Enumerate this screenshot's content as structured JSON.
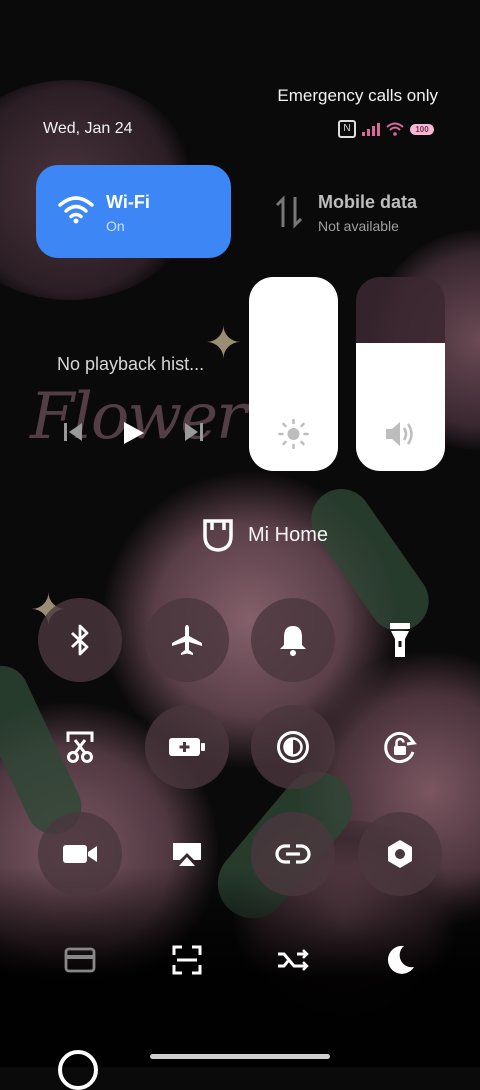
{
  "status": {
    "emergency": "Emergency calls only",
    "date": "Wed, Jan 24",
    "battery": "100"
  },
  "tiles": {
    "wifi": {
      "title": "Wi-Fi",
      "state": "On"
    },
    "mobile": {
      "title": "Mobile data",
      "state": "Not available"
    }
  },
  "media": {
    "title": "No playback hist..."
  },
  "sliders": {
    "brightness_level": 1.0,
    "volume_level": 0.66
  },
  "mihome": {
    "label": "Mi Home"
  },
  "decor": {
    "wallpaper_text": "Flower"
  },
  "toggles": [
    {
      "name": "bluetooth-icon"
    },
    {
      "name": "airplane-icon"
    },
    {
      "name": "bell-icon"
    },
    {
      "name": "flashlight-icon"
    },
    {
      "name": "screenshot-icon"
    },
    {
      "name": "battery-saver-icon"
    },
    {
      "name": "dark-mode-icon"
    },
    {
      "name": "auto-rotate-icon"
    },
    {
      "name": "video-camera-icon"
    },
    {
      "name": "cast-icon"
    },
    {
      "name": "link-icon"
    },
    {
      "name": "settings-icon"
    },
    {
      "name": "card-icon"
    },
    {
      "name": "scan-icon"
    },
    {
      "name": "swap-icon"
    },
    {
      "name": "moon-icon"
    }
  ],
  "colors": {
    "accent": "#3d86f5",
    "signal": "#d76a9a"
  }
}
